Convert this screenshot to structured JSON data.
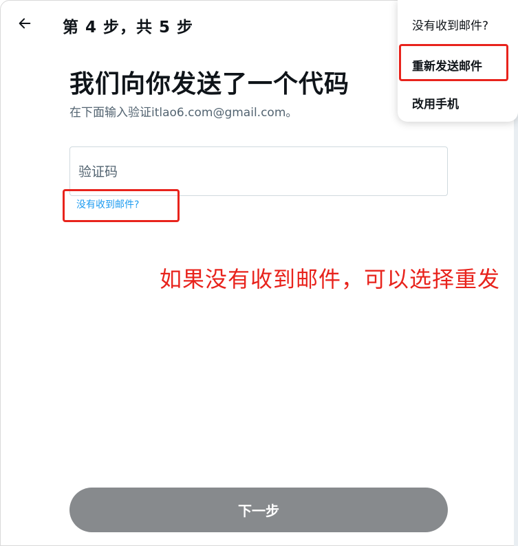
{
  "header": {
    "back_icon": "arrow-left-icon",
    "step_title": "第 4 步，共 5 步"
  },
  "main": {
    "heading": "我们向你发送了一个代码",
    "subtext": "在下面输入验证itlao6.com@gmail.com。",
    "code_input": {
      "placeholder": "验证码",
      "value": ""
    },
    "no_email_link": "没有收到邮件?",
    "next_button": "下一步"
  },
  "dropdown": {
    "header": "没有收到邮件?",
    "items": [
      "重新发送邮件",
      "改用手机"
    ]
  },
  "annotation": {
    "text": "如果没有收到邮件，可以选择重发",
    "color": "#e8231c"
  },
  "colors": {
    "link": "#1d9bf0",
    "button_disabled": "#878a8d",
    "highlight": "#e8231c"
  }
}
